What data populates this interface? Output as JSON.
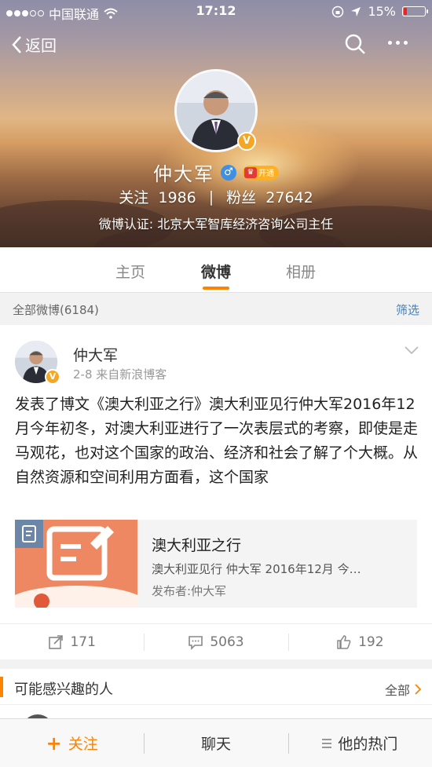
{
  "status_bar": {
    "carrier": "中国联通",
    "time": "17:12",
    "battery_percent": "15%",
    "battery_level": 0.15
  },
  "nav": {
    "back_label": "返回"
  },
  "profile": {
    "name": "仲大军",
    "vip_label": "开通",
    "following_label": "关注",
    "following_count": "1986",
    "followers_label": "粉丝",
    "followers_count": "27642",
    "verification": "微博认证: 北京大军智库经济咨询公司主任"
  },
  "tabs": [
    {
      "label": "主页"
    },
    {
      "label": "微博"
    },
    {
      "label": "相册"
    }
  ],
  "filter_bar": {
    "count_label": "全部微博(6184)",
    "filter_label": "筛选"
  },
  "post": {
    "author": "仲大军",
    "meta": "2-8  来自新浪博客",
    "text": "发表了博文《澳大利亚之行》澳大利亚见行仲大军2016年12月今年初冬，对澳大利亚进行了一次表层式的考察，即使是走马观花，也对这个国家的政治、经济和社会了解了个大概。从自然资源和空间利用方面看，这个国家",
    "card": {
      "title": "澳大利亚之行",
      "subtitle": "澳大利亚见行  仲大军  2016年12月  今…",
      "publisher": "发布者:仲大军"
    },
    "reposts": "171",
    "comments": "5063",
    "likes": "192"
  },
  "suggestions": {
    "title": "可能感兴趣的人",
    "all_label": "全部"
  },
  "bottom_bar": {
    "follow_label": "关注",
    "chat_label": "聊天",
    "hot_label": "他的热门"
  },
  "colors": {
    "accent": "#ff8200",
    "link": "#4a7fb0",
    "verified_badge": "#f5a623",
    "gender_badge": "#3f8fe3"
  }
}
